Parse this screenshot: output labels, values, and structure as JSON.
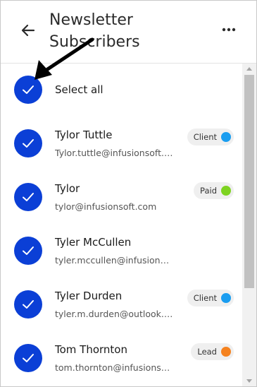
{
  "header": {
    "title": "Newsletter Subscribers"
  },
  "select_all": {
    "label": "Select all",
    "checked": true
  },
  "subscribers": [
    {
      "name": "Tylor Tuttle",
      "email": "Tylor.tuttle@infusionsoft.com",
      "tag": "Client",
      "tag_color": "#1a9df0",
      "checked": true
    },
    {
      "name": "Tylor",
      "email": "tylor@infusionsoft.com",
      "tag": "Paid",
      "tag_color": "#7ed321",
      "checked": true
    },
    {
      "name": "Tyler McCullen",
      "email": "tyler.mccullen@infusionsoft.com",
      "tag": "",
      "tag_color": "",
      "checked": true
    },
    {
      "name": "Tyler Durden",
      "email": "tyler.m.durden@outlook.com",
      "tag": "Client",
      "tag_color": "#1a9df0",
      "checked": true
    },
    {
      "name": "Tom Thornton",
      "email": "tom.thornton@infusionsoft.com",
      "tag": "Lead",
      "tag_color": "#f5821f",
      "checked": true
    }
  ],
  "colors": {
    "accent": "#0b3fd6"
  },
  "icons": {
    "back": "arrow-left-icon",
    "more": "more-horizontal-icon",
    "check": "check-icon"
  }
}
